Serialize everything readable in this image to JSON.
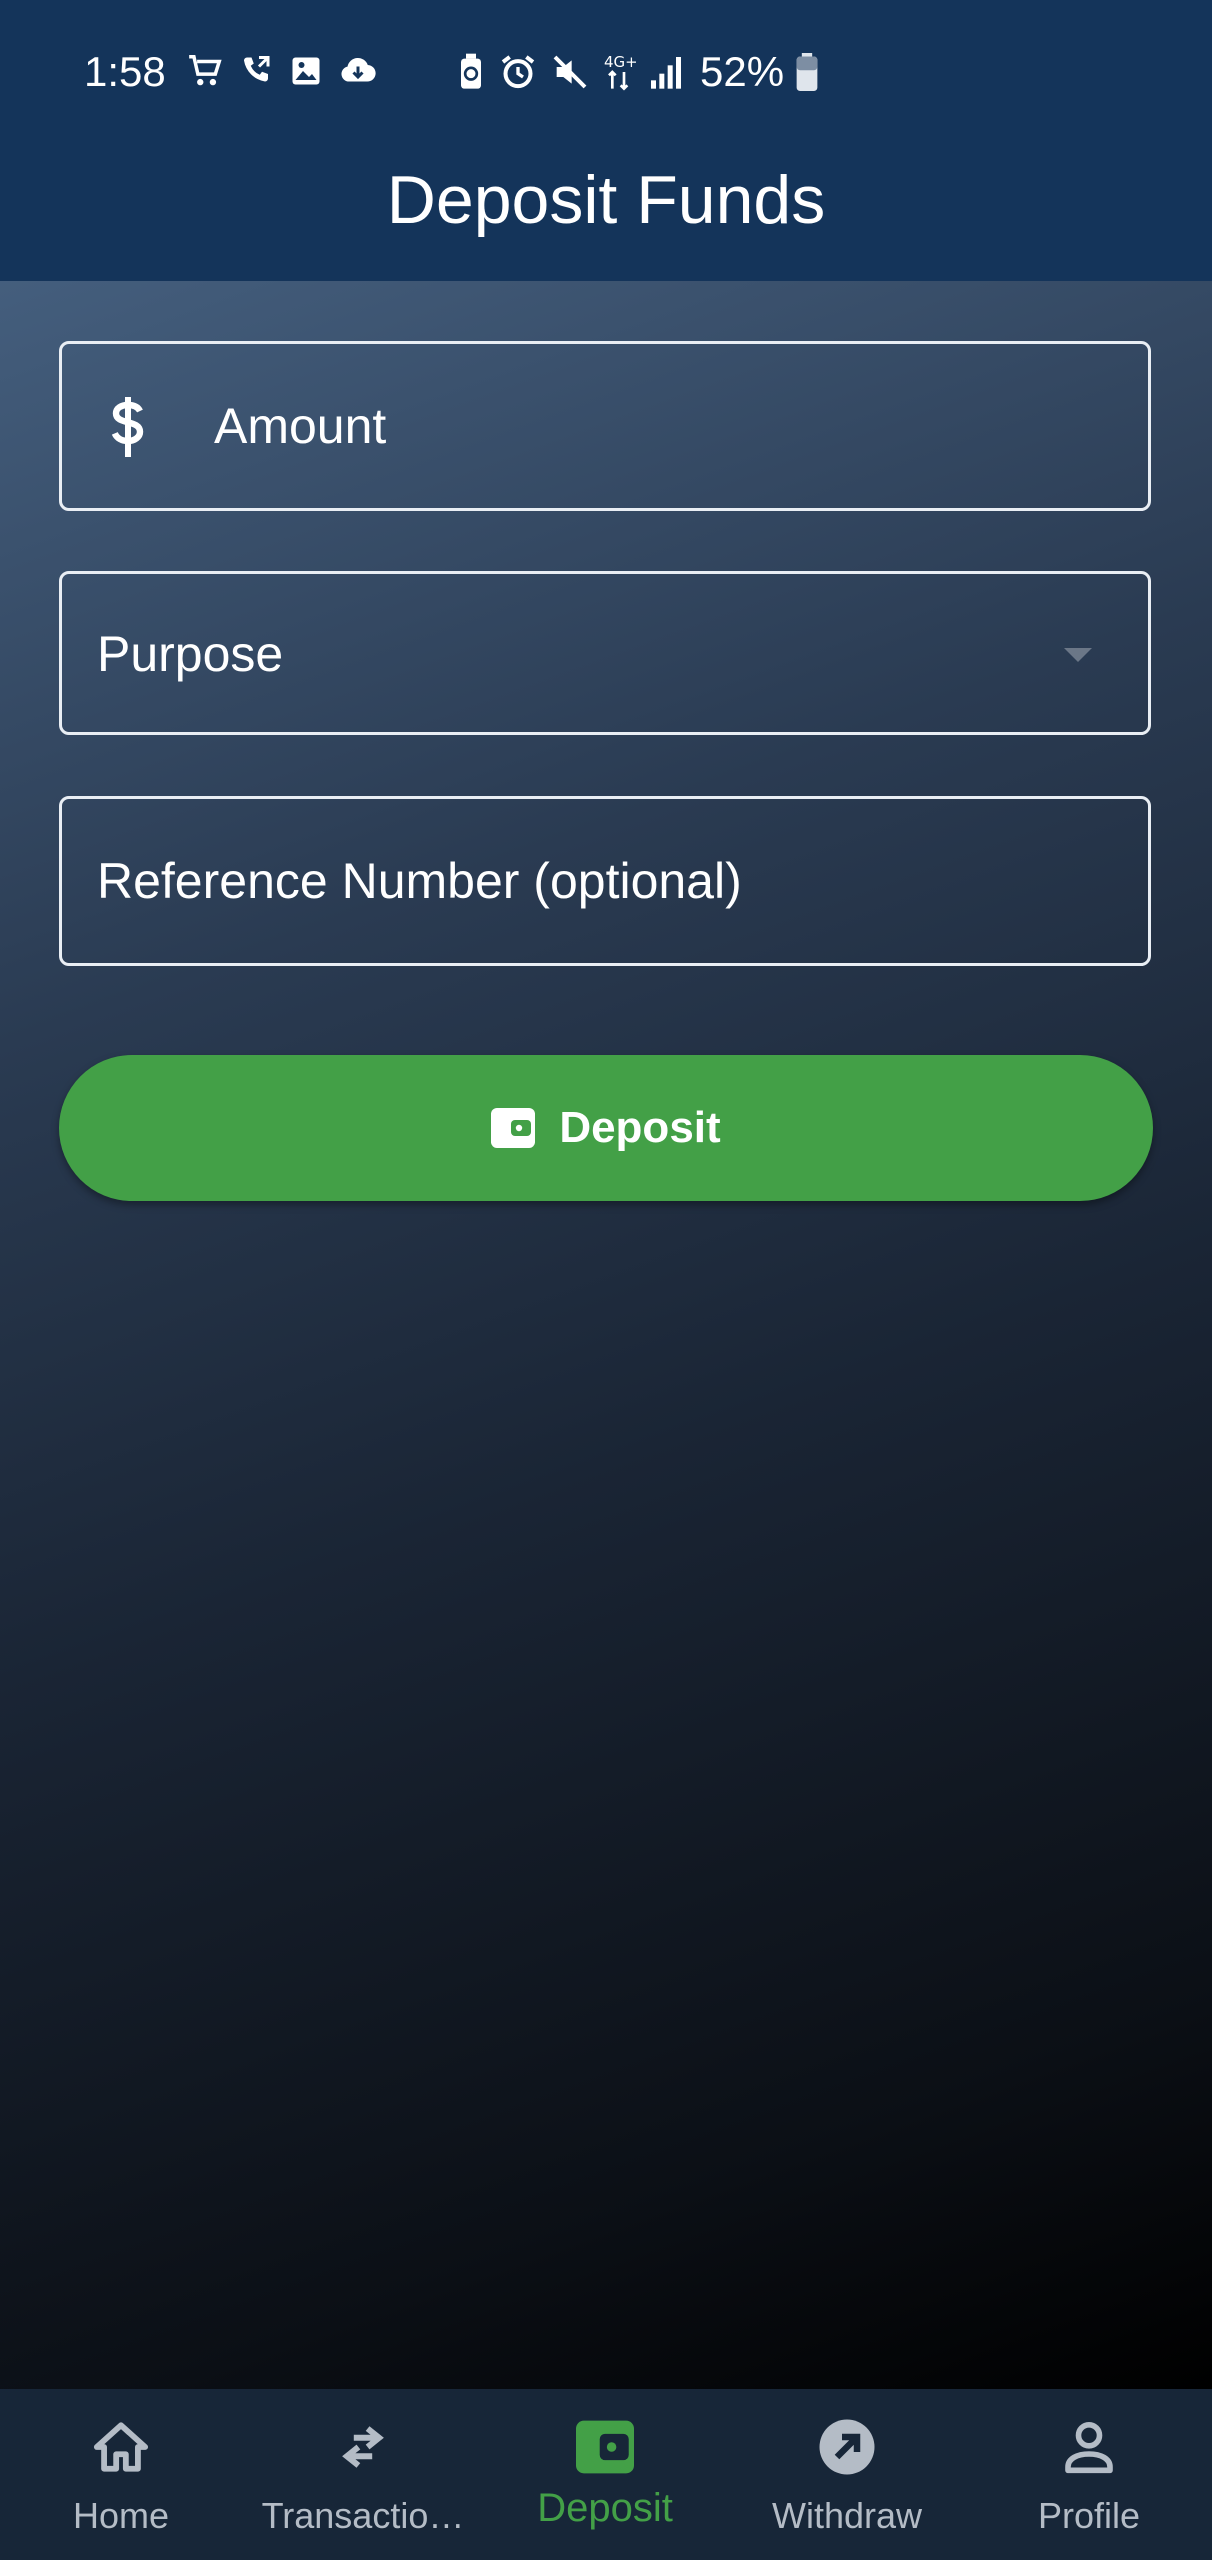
{
  "status_bar": {
    "time": "1:58",
    "battery": "52%",
    "network": "4G+"
  },
  "header": {
    "title": "Deposit Funds"
  },
  "form": {
    "amount_label": "Amount",
    "amount_icon": "dollar-icon",
    "purpose_label": "Purpose",
    "reference_label": "Reference Number (optional)",
    "deposit_button_label": "Deposit",
    "deposit_button_icon": "wallet-icon"
  },
  "colors": {
    "header": "#14345a",
    "accent": "#43a047",
    "nav_background": "#172638",
    "nav_inactive": "#b4bcc6"
  },
  "bottom_nav": {
    "items": [
      {
        "label": "Home",
        "icon": "home-icon"
      },
      {
        "label": "Transactio…",
        "icon": "swap-arrows-icon"
      },
      {
        "label": "Deposit",
        "icon": "wallet-icon",
        "active": true
      },
      {
        "label": "Withdraw",
        "icon": "arrow-up-right-icon"
      },
      {
        "label": "Profile",
        "icon": "person-icon"
      }
    ]
  }
}
